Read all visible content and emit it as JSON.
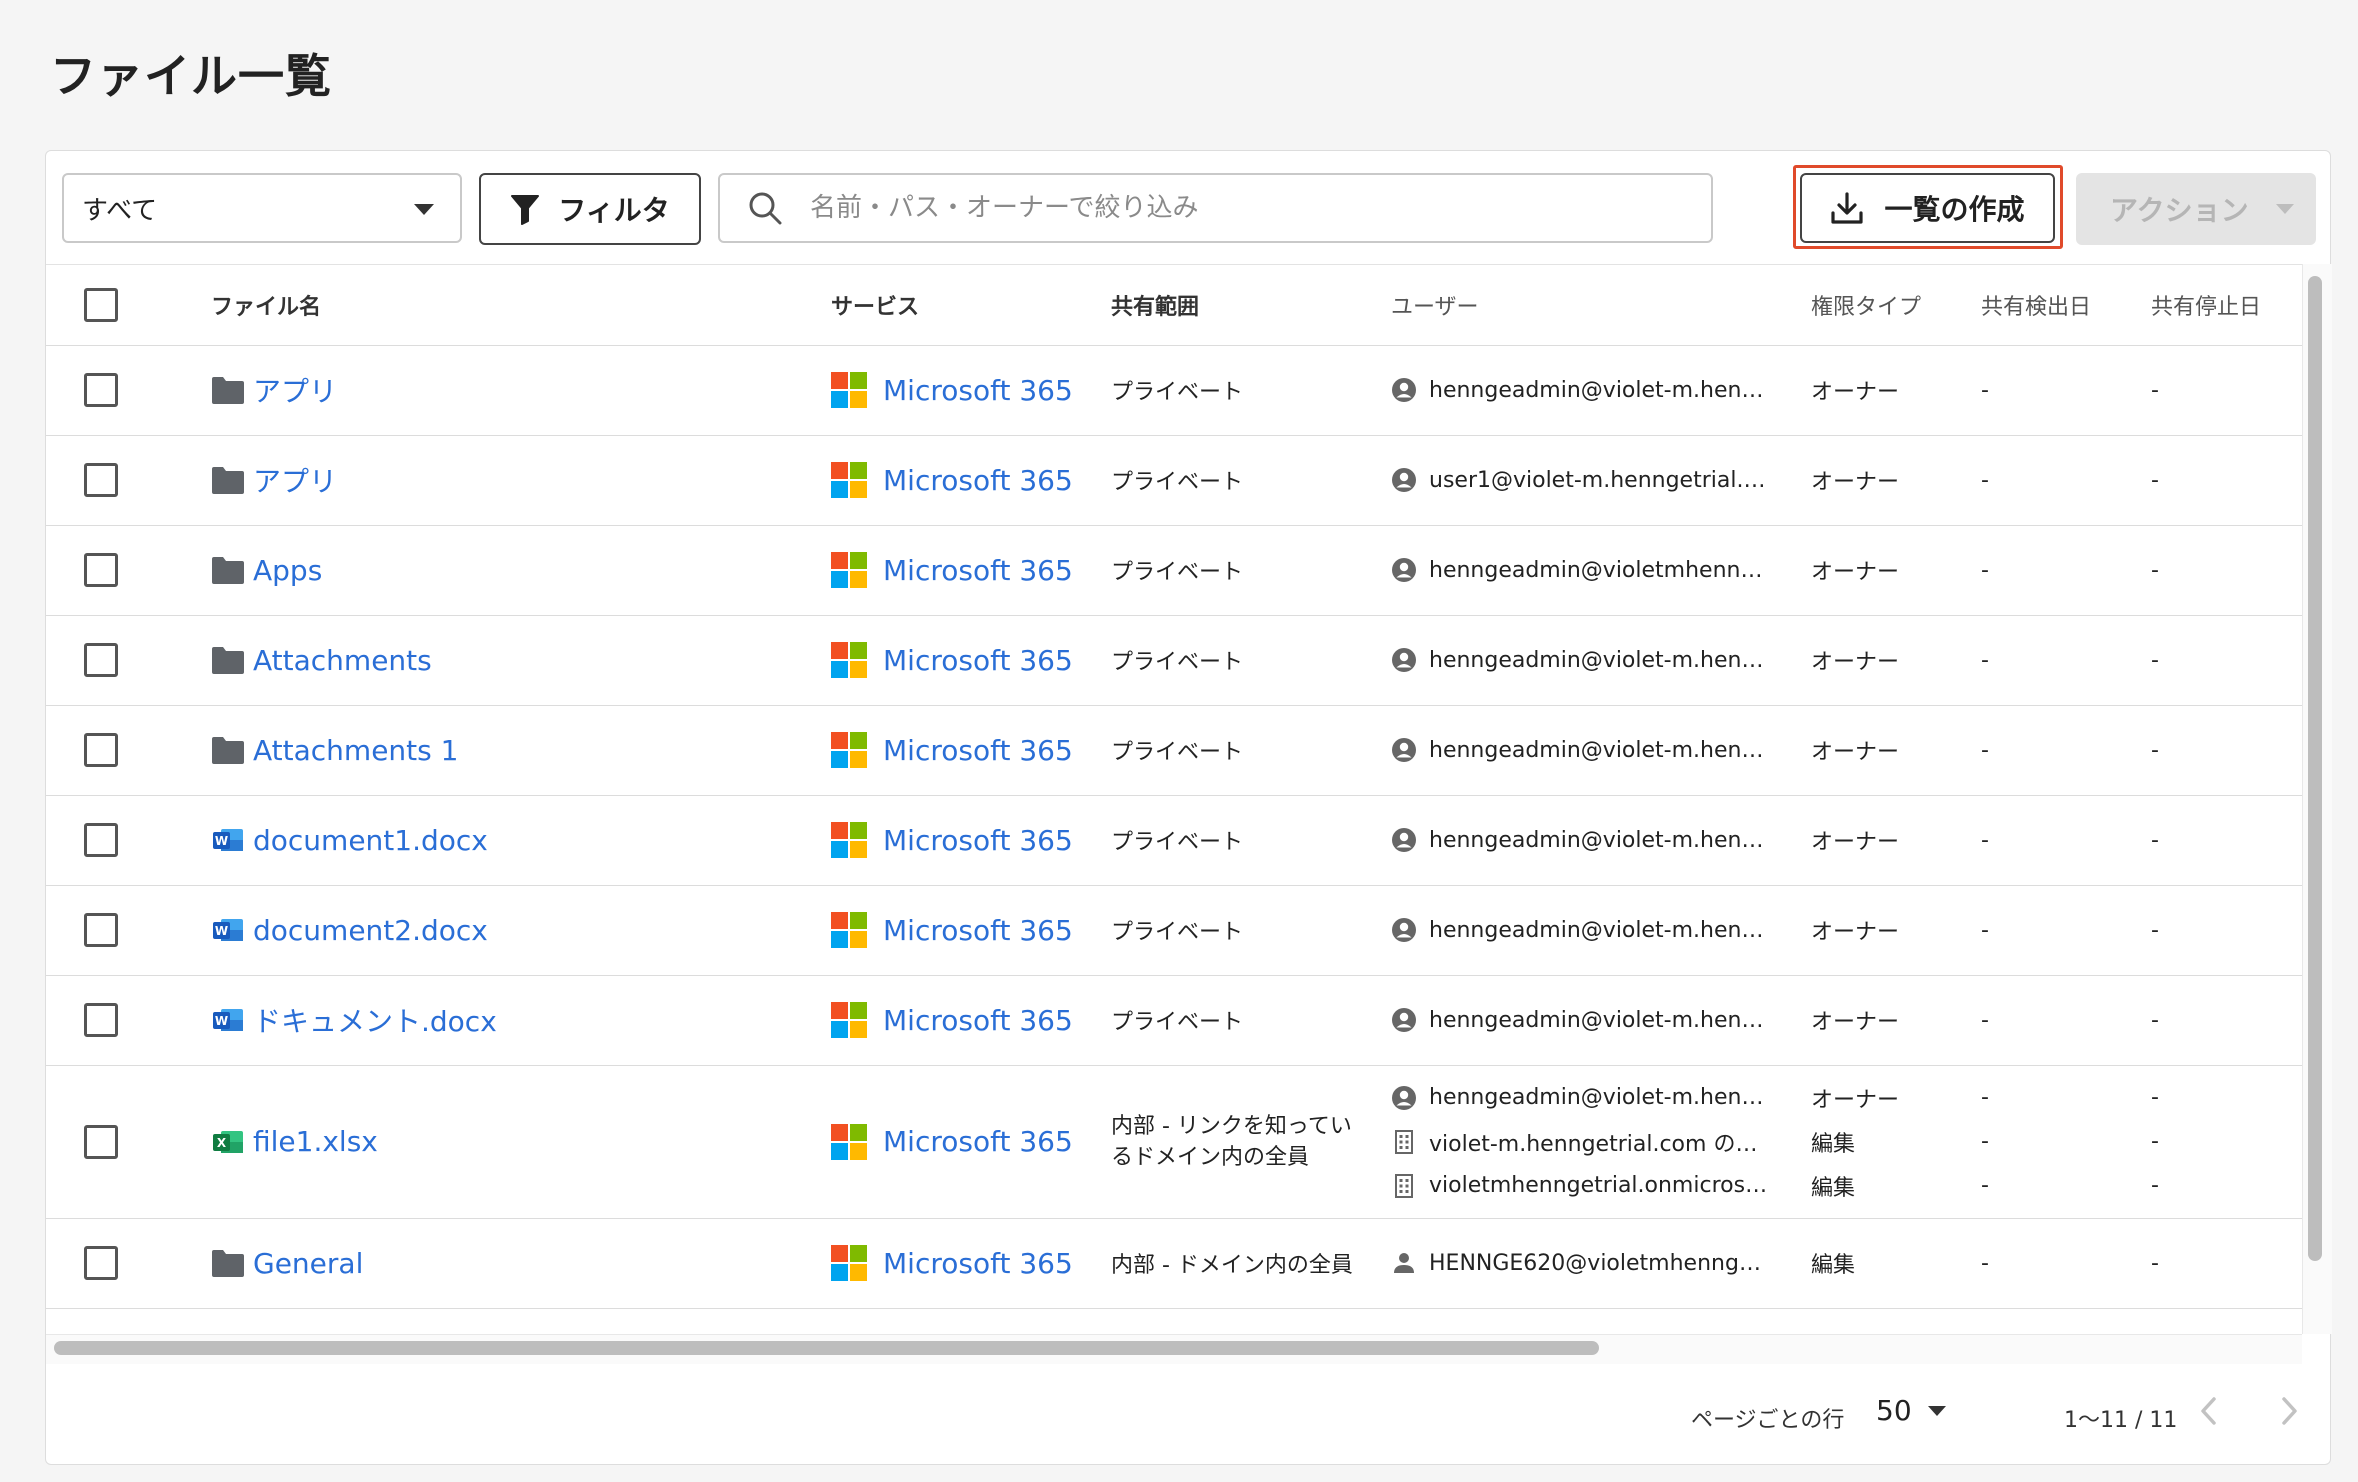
{
  "page_title": "ファイル一覧",
  "toolbar": {
    "scope_select": "すべて",
    "filter_label": "フィルタ",
    "search_placeholder": "名前・パス・オーナーで絞り込み",
    "export_label": "一覧の作成",
    "action_label": "アクション"
  },
  "colors": {
    "link": "#2a6ed6",
    "highlight_outline": "#e04a2a",
    "ms_red": "#f25022",
    "ms_green": "#7fba00",
    "ms_blue": "#00a4ef",
    "ms_yellow": "#ffb900",
    "word_blue": "#185abd",
    "excel_green": "#107c41",
    "folder_gray": "#5f6368"
  },
  "table": {
    "headers": {
      "name": "ファイル名",
      "service": "サービス",
      "scope": "共有範囲",
      "user": "ユーザー",
      "permission": "権限タイプ",
      "detected": "共有検出日",
      "stopped": "共有停止日"
    },
    "rows": [
      {
        "icon": "folder-icon",
        "name": "アプリ",
        "service": "Microsoft 365",
        "scope": "プライベート",
        "users": [
          {
            "icon": "user-circle-icon",
            "text": "henngeadmin@violet-m.henn…",
            "perm": "オーナー",
            "detected": "-",
            "stopped": "-"
          }
        ]
      },
      {
        "icon": "folder-icon",
        "name": "アプリ",
        "service": "Microsoft 365",
        "scope": "プライベート",
        "users": [
          {
            "icon": "user-circle-icon",
            "text": "user1@violet-m.henngetrial.c…",
            "perm": "オーナー",
            "detected": "-",
            "stopped": "-"
          }
        ]
      },
      {
        "icon": "folder-icon",
        "name": "Apps",
        "service": "Microsoft 365",
        "scope": "プライベート",
        "users": [
          {
            "icon": "user-circle-icon",
            "text": "henngeadmin@violetmhenng…",
            "perm": "オーナー",
            "detected": "-",
            "stopped": "-"
          }
        ]
      },
      {
        "icon": "folder-icon",
        "name": "Attachments",
        "service": "Microsoft 365",
        "scope": "プライベート",
        "users": [
          {
            "icon": "user-circle-icon",
            "text": "henngeadmin@violet-m.henn…",
            "perm": "オーナー",
            "detected": "-",
            "stopped": "-"
          }
        ]
      },
      {
        "icon": "folder-icon",
        "name": "Attachments 1",
        "service": "Microsoft 365",
        "scope": "プライベート",
        "users": [
          {
            "icon": "user-circle-icon",
            "text": "henngeadmin@violet-m.henn…",
            "perm": "オーナー",
            "detected": "-",
            "stopped": "-"
          }
        ]
      },
      {
        "icon": "word-icon",
        "name": "document1.docx",
        "service": "Microsoft 365",
        "scope": "プライベート",
        "users": [
          {
            "icon": "user-circle-icon",
            "text": "henngeadmin@violet-m.henn…",
            "perm": "オーナー",
            "detected": "-",
            "stopped": "-"
          }
        ]
      },
      {
        "icon": "word-icon",
        "name": "document2.docx",
        "service": "Microsoft 365",
        "scope": "プライベート",
        "users": [
          {
            "icon": "user-circle-icon",
            "text": "henngeadmin@violet-m.henn…",
            "perm": "オーナー",
            "detected": "-",
            "stopped": "-"
          }
        ]
      },
      {
        "icon": "word-icon",
        "name": "ドキュメント.docx",
        "service": "Microsoft 365",
        "scope": "プライベート",
        "users": [
          {
            "icon": "user-circle-icon",
            "text": "henngeadmin@violet-m.henn…",
            "perm": "オーナー",
            "detected": "-",
            "stopped": "-"
          }
        ]
      },
      {
        "icon": "excel-icon",
        "name": "file1.xlsx",
        "service": "Microsoft 365",
        "scope": "内部 - リンクを知っているドメイン内の全員",
        "users": [
          {
            "icon": "user-circle-icon",
            "text": "henngeadmin@violet-m.henn…",
            "perm": "オーナー",
            "detected": "-",
            "stopped": "-"
          },
          {
            "icon": "building-icon",
            "text": "violet-m.henngetrial.com の全員",
            "perm": "編集",
            "detected": "-",
            "stopped": "-"
          },
          {
            "icon": "building-icon",
            "text": "violetmhenngetrial.onmicroso…",
            "perm": "編集",
            "detected": "-",
            "stopped": "-"
          }
        ]
      },
      {
        "icon": "folder-icon",
        "name": "General",
        "service": "Microsoft 365",
        "scope": "内部 - ドメイン内の全員",
        "users": [
          {
            "icon": "person-icon",
            "text": "HENNGE620@violetmhennget…",
            "perm": "編集",
            "detected": "-",
            "stopped": "-"
          }
        ]
      }
    ]
  },
  "pagination": {
    "rows_per_page_label": "ページごとの行",
    "rows_per_page": "50",
    "range": "1〜11 / 11"
  }
}
